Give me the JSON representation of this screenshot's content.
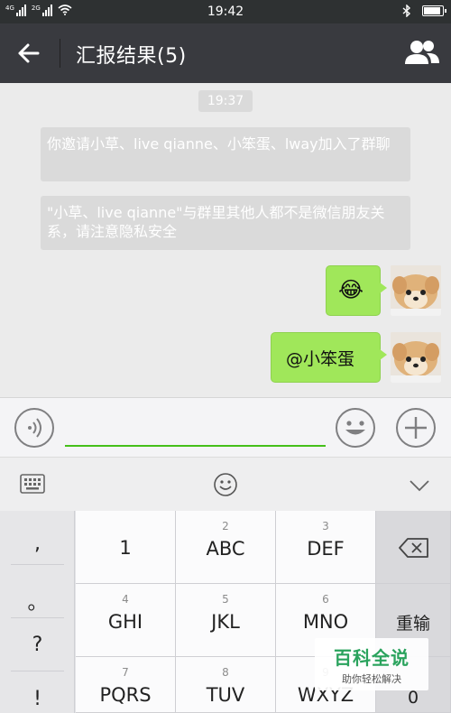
{
  "status_bar": {
    "time": "19:42",
    "net1": "4G",
    "net2": "2G",
    "battery_level": 0.9
  },
  "header": {
    "title": "汇报结果(5)",
    "back_icon": "arrow-left-icon",
    "members_icon": "group-icon"
  },
  "chat": {
    "timestamp": "19:37",
    "system_messages": [
      "你邀请小草、live qianne、小笨蛋、lway加入了群聊",
      "\"小草、live qianne\"与群里其他人都不是微信朋友关系，请注意隐私安全"
    ],
    "messages": [
      {
        "type": "emoji",
        "content": "😂",
        "sender": "me"
      },
      {
        "type": "text",
        "content": "@小笨蛋",
        "sender": "me"
      }
    ]
  },
  "input_bar": {
    "value": "",
    "placeholder": ""
  },
  "keyboard": {
    "punctuation": [
      ",",
      "。",
      "?",
      "!"
    ],
    "rows": [
      [
        {
          "num": "",
          "label": "1"
        },
        {
          "num": "2",
          "label": "ABC"
        },
        {
          "num": "3",
          "label": "DEF"
        }
      ],
      [
        {
          "num": "4",
          "label": "GHI"
        },
        {
          "num": "5",
          "label": "JKL"
        },
        {
          "num": "6",
          "label": "MNO"
        }
      ],
      [
        {
          "num": "7",
          "label": "PQRS"
        },
        {
          "num": "8",
          "label": "TUV"
        },
        {
          "num": "9",
          "label": "WXYZ"
        }
      ]
    ],
    "delete_label": "⌫",
    "reenter_label": "重输",
    "zero_label": "0"
  },
  "watermark": {
    "title": "百科全说",
    "subtitle": "助你轻松解决"
  },
  "colors": {
    "accent": "#45c01a",
    "bubble": "#a0e75a",
    "header": "#393a3f"
  }
}
